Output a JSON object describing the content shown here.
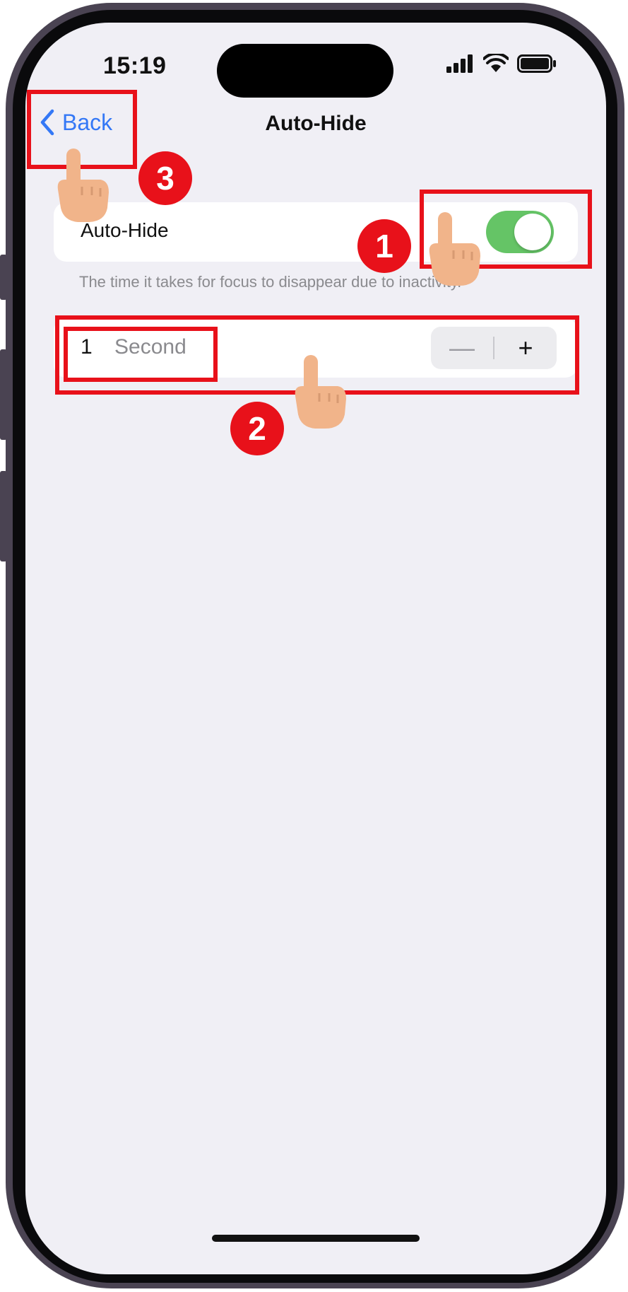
{
  "status_bar": {
    "time": "15:19"
  },
  "nav": {
    "back_label": "Back",
    "title": "Auto-Hide"
  },
  "toggle_row": {
    "label": "Auto-Hide",
    "enabled": true,
    "footnote": "The time it takes for focus to disappear due to inactivity."
  },
  "stepper_row": {
    "value": "1",
    "unit": "Second",
    "minus_label": "—",
    "plus_label": "+"
  },
  "annotations": [
    {
      "number": "1",
      "target": "auto-hide-toggle"
    },
    {
      "number": "2",
      "target": "duration-stepper"
    },
    {
      "number": "3",
      "target": "back-button"
    }
  ],
  "colors": {
    "accent": "#3478f6",
    "toggle_on": "#65c466",
    "annotation": "#e8111a",
    "background": "#f0eff5"
  }
}
